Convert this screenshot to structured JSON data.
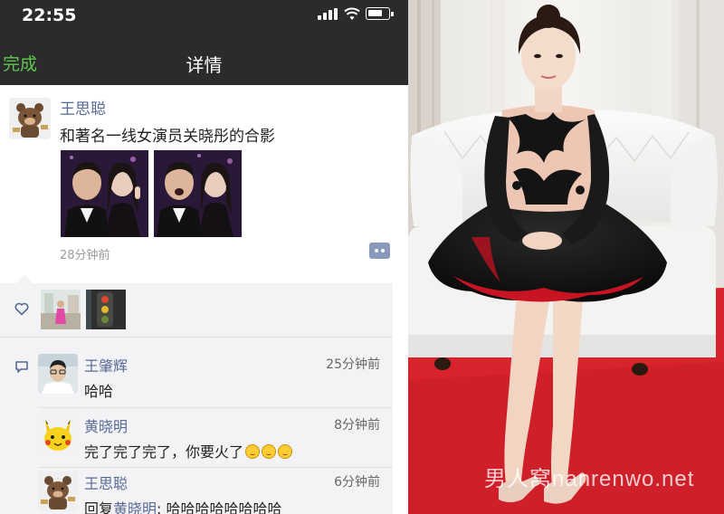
{
  "status": {
    "time": "22:55"
  },
  "nav": {
    "done_label": "完成",
    "title": "详情"
  },
  "post": {
    "author": "王思聪",
    "text": "和著名一线女演员关晓彤的合影",
    "time": "28分钟前"
  },
  "comments": [
    {
      "name": "王肇辉",
      "time": "25分钟前",
      "text": "哈哈"
    },
    {
      "name": "黄晓明",
      "time": "8分钟前",
      "text": "完了完了完了，你要火了"
    },
    {
      "name": "王思聪",
      "time": "6分钟前",
      "reply_prefix": "回复",
      "reply_to": "黄晓明",
      "text": ": 哈哈哈哈哈哈哈哈"
    }
  ],
  "watermark": "男人窝nanrenwo.net",
  "colors": {
    "nav_bg": "#2b2b2e",
    "done_green": "#5ec94d",
    "name_blue": "#576b95",
    "carpet_red": "#d8222c"
  },
  "icons": [
    "signal-icon",
    "wifi-icon",
    "battery-icon",
    "more-icon",
    "heart-icon",
    "comment-icon",
    "emoji-icon"
  ]
}
